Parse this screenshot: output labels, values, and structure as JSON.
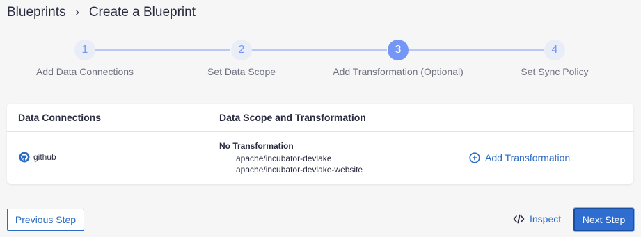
{
  "breadcrumb": {
    "root": "Blueprints",
    "separator": "›",
    "current": "Create a Blueprint"
  },
  "steps": [
    {
      "number": "1",
      "label": "Add Data Connections",
      "state": "inactive"
    },
    {
      "number": "2",
      "label": "Set Data Scope",
      "state": "inactive"
    },
    {
      "number": "3",
      "label": "Add Transformation (Optional)",
      "state": "active"
    },
    {
      "number": "4",
      "label": "Set Sync Policy",
      "state": "inactive"
    }
  ],
  "table": {
    "headers": [
      "Data Connections",
      "Data Scope and Transformation"
    ],
    "rows": [
      {
        "connection": "github",
        "connection_icon": "github-icon",
        "transformation_title": "No Transformation",
        "repos": [
          "apache/incubator-devlake",
          "apache/incubator-devlake-website"
        ],
        "action_label": "Add Transformation",
        "action_icon": "plus-circle-icon"
      }
    ]
  },
  "footer": {
    "previous_label": "Previous Step",
    "inspect_label": "Inspect",
    "inspect_icon": "code-icon",
    "next_label": "Next Step"
  },
  "colors": {
    "accent": "#2b6bc4",
    "step_active": "#7497f7",
    "step_inactive_bg": "#e8edf7",
    "primary_button": "#2f6ed0"
  }
}
